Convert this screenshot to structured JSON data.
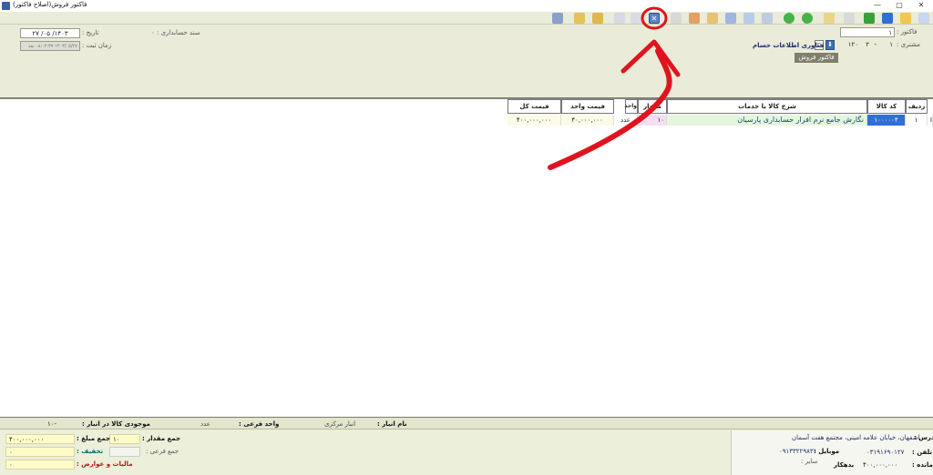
{
  "window": {
    "title": "فاکتور فروش(اصلاح فاکتور)",
    "controls": {
      "minimize": "—",
      "maximize": "▢",
      "close": "✕"
    }
  },
  "toolbar": {
    "icons": [
      "new-icon",
      "edit-icon",
      "save-icon",
      "save-all-icon",
      "copy-icon",
      "paste-icon",
      "forward-icon",
      "back-icon",
      "refresh-icon",
      "list-icon",
      "grid-icon",
      "filter-icon",
      "print-icon",
      "print-preview-icon",
      "cancel-icon",
      "delete-icon",
      "upload-icon",
      "download-icon",
      "export-icon",
      "import-icon",
      "settings-icon"
    ],
    "active_icon": "cancel-icon",
    "active_glyph": "✕"
  },
  "header": {
    "invoice_label": "فاکتور :",
    "invoice_value": "۱",
    "tooltip": "فاکتور فروش",
    "customer_label": "مشتری :",
    "customer_code": "۱",
    "customer_sep": "-",
    "customer_num": "۲",
    "customer_num2": "۱۲۰",
    "customer_name": "فناوری اطلاعات حسام",
    "doc_label": "سند حسابداری : ۰",
    "date_label": "تاریخ :",
    "date_value": "۱۴۰۳/ ۰۵/ ۲۷",
    "time_label": "زمان ثبت :",
    "time_value": "۱۴۰۳/۰۵/۲۷ ۰۸:۰۲:۳۷ بعد"
  },
  "grid": {
    "columns": [
      "ردیف",
      "کد کالا",
      "شرح کالا یا خدمات",
      "واحد",
      "مقدار",
      "فیمت واحد",
      "فیمت کل"
    ],
    "rows": [
      {
        "row_no": "۱",
        "code": "۱۰۰۰۰۰۴",
        "description": "نگارش جامع نرم افزار حسابداری پارسیان",
        "unit": "عدد",
        "quantity": "۱۰",
        "unit_price": "۴۰,۰۰۰,۰۰۰",
        "total": "۴۰۰,۰۰۰,۰۰۰"
      }
    ],
    "marker": "I"
  },
  "footer": {
    "warehouse_label": "نام انبار :",
    "warehouse_value": "انبار مرکزی",
    "subunit_label": "واحد فرعی :",
    "subunit_value": "عدد",
    "stock_label": "موجودی کالا در انبار :",
    "stock_value": "-۱۰",
    "sum_qty_label": "جمع مقدار :",
    "sum_qty_value": "۱۰",
    "sum_sub_label": "جمع فرعی :",
    "sum_amount_label": "جمع مبلغ :",
    "sum_amount_value": "۴۰۰,۰۰۰,۰۰۰",
    "discount_label": "تخفیف :",
    "discount_value": "۰",
    "tax_label": "مالیات و عوارض :",
    "tax_value": "۰",
    "address_label": "آدرس :",
    "address_value": "اصفهان، خیابان علامه امینی، مجتمع هفت آسمان",
    "phone_label": "تلفن :",
    "phone_value": "۰۳۱۹۱۶۹۰۱۲۷",
    "mobile_label": "موبایل :",
    "mobile_value": "۰۹۱۳۳۲۲۹۸۳۱",
    "balance_label": "مانده :",
    "balance_value": "۴۰۰,۰۰۰,۰۰۰",
    "balance_status": "بدهکار",
    "other_label": "سایر :"
  },
  "colors": {
    "panel_bg": "#eaecd9",
    "annotation_red": "#e0141e",
    "active_blue": "#5b84c9",
    "code_cell": "#2f6fd6",
    "desc_cell": "#e3f7dc",
    "qty_cell": "#f6def2"
  }
}
